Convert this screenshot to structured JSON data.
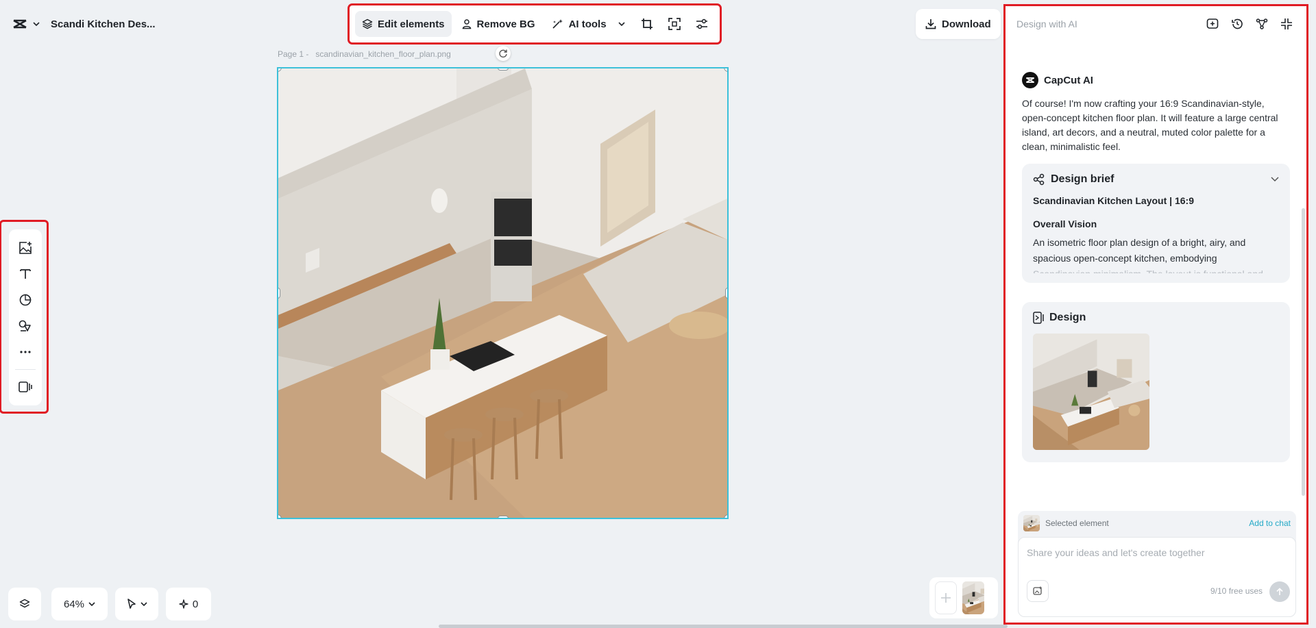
{
  "project": {
    "name": "Scandi Kitchen Des..."
  },
  "toolbar": {
    "edit_elements": "Edit elements",
    "remove_bg": "Remove BG",
    "ai_tools": "AI tools"
  },
  "download": {
    "label": "Download"
  },
  "canvas": {
    "page_label": "Page 1 -",
    "file_name": "scandinavian_kitchen_floor_plan.png"
  },
  "bottom": {
    "zoom": "64%",
    "credits": "0"
  },
  "panel": {
    "title": "Design with AI",
    "bot_name": "CapCut AI",
    "message": "Of course! I'm now crafting your 16:9 Scandinavian-style, open-concept kitchen floor plan. It will feature a large central island, art decors, and a neutral, muted color palette for a clean, minimalistic feel.",
    "brief": {
      "title": "Design brief",
      "subtitle": "Scandinavian Kitchen Layout | 16:9",
      "section": "Overall Vision",
      "text": "An isometric floor plan design of a bright, airy, and spacious open-concept kitchen, embodying",
      "fade": "Scandinavian minimalism. The layout is functional and"
    },
    "design_title": "Design",
    "selected_label": "Selected element",
    "add_to_chat": "Add to chat",
    "input_placeholder": "Share your ideas and let's create together",
    "free_uses": "9/10 free uses"
  },
  "colors": {
    "accent": "#3cc0d9",
    "highlight": "#e01b24",
    "link": "#23a9c7"
  }
}
